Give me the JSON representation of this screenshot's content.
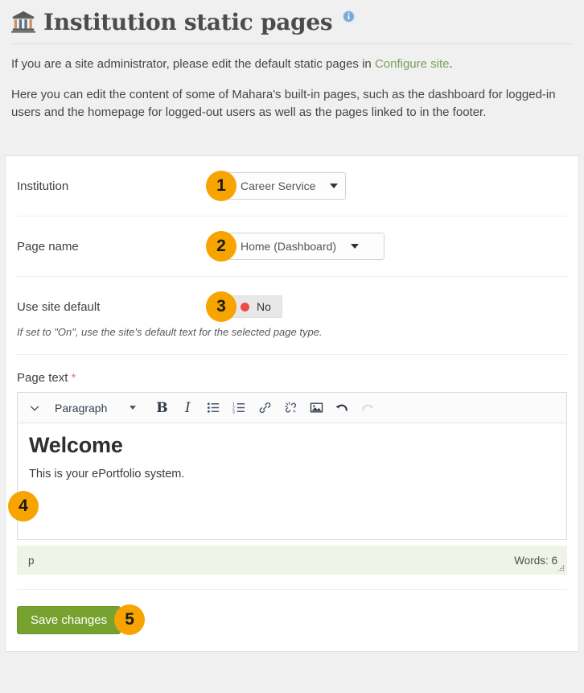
{
  "header": {
    "title": "Institution static pages",
    "institution_icon": "bank-institution-icon",
    "info_icon": "info-circle-icon"
  },
  "intro": {
    "paragraph1_before": "If you are a site administrator, please edit the default static pages in ",
    "paragraph1_link": "Configure site",
    "paragraph1_after": ".",
    "paragraph2": "Here you can edit the content of some of Mahara's built-in pages, such as the dashboard for logged-in users and the homepage for logged-out users as well as the pages linked to in the footer."
  },
  "form": {
    "institution": {
      "label": "Institution",
      "badge": "1",
      "selected": "Career Service",
      "options": [
        "Career Service"
      ]
    },
    "page_name": {
      "label": "Page name",
      "badge": "2",
      "selected": "Home (Dashboard)",
      "options": [
        "Home (Dashboard)"
      ]
    },
    "use_site_default": {
      "label": "Use site default",
      "badge": "3",
      "value": "No",
      "status_color": "#ef4a4a",
      "help": "If set to \"On\", use the site's default text for the selected page type."
    },
    "page_text": {
      "label": "Page text",
      "required_marker": "*",
      "badge": "4"
    }
  },
  "editor": {
    "toolbar": {
      "chevron_icon": "chevron-down-icon",
      "format_label": "Paragraph",
      "bold_label": "B",
      "italic_label": "I",
      "bullet_list_icon": "bullet-list-icon",
      "numbered_list_icon": "numbered-list-icon",
      "link_icon": "link-icon",
      "unlink_icon": "unlink-icon",
      "image_icon": "image-icon",
      "undo_icon": "undo-icon",
      "redo_icon": "redo-icon"
    },
    "content": {
      "heading": "Welcome",
      "paragraph": "This is your ePortfolio system."
    },
    "status": {
      "element_path": "p",
      "word_count": "Words: 6",
      "resize_grip_icon": "resize-grip-icon"
    }
  },
  "footer": {
    "save_label": "Save changes",
    "badge": "5"
  },
  "colors": {
    "accent_badge": "#f7a400",
    "link_green": "#7ba05b",
    "save_green": "#78a22f",
    "status_bar": "#eef4e8",
    "page_background": "#f0f0f0"
  }
}
